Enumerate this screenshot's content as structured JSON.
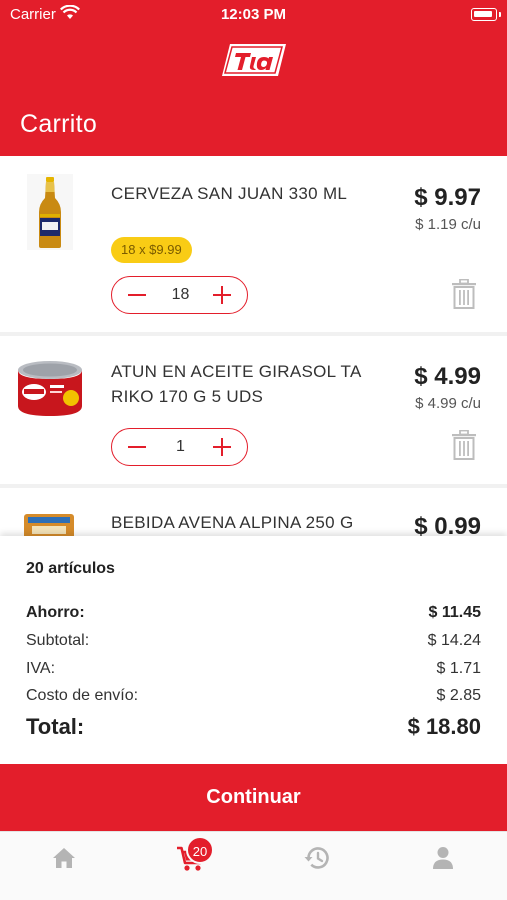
{
  "status_bar": {
    "carrier": "Carrier",
    "time": "12:03 PM"
  },
  "header": {
    "logo_text": "Tía",
    "title": "Carrito"
  },
  "colors": {
    "brand_red": "#e31e2b",
    "promo_yellow": "#f9cc15"
  },
  "cart": {
    "items": [
      {
        "name": "CERVEZA SAN JUAN 330 ML",
        "price": "$ 9.97",
        "unit_price": "$ 1.19 c/u",
        "promo": "18 x $9.99",
        "quantity": "18"
      },
      {
        "name": "ATUN EN ACEITE GIRASOL TA RIKO 170 G 5 UDS",
        "price": "$ 4.99",
        "unit_price": "$ 4.99 c/u",
        "quantity": "1"
      },
      {
        "name": "BEBIDA AVENA ALPINA 250 G",
        "price": "$ 0.99"
      }
    ]
  },
  "summary": {
    "count": "20 artículos",
    "savings_label": "Ahorro:",
    "savings": "$ 11.45",
    "subtotal_label": "Subtotal:",
    "subtotal": "$ 14.24",
    "iva_label": "IVA:",
    "iva": "$ 1.71",
    "shipping_label": "Costo de envío:",
    "shipping": "$ 2.85",
    "total_label": "Total:",
    "total": "$ 18.80"
  },
  "continue_label": "Continuar",
  "tabbar": {
    "cart_badge": "20",
    "icons": [
      "home-icon",
      "cart-icon",
      "history-icon",
      "user-icon"
    ]
  }
}
